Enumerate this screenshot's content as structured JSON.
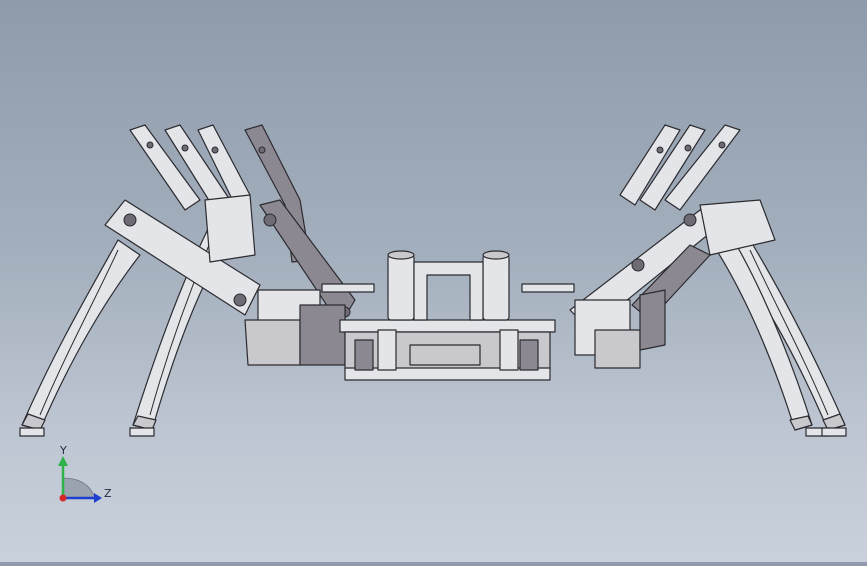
{
  "viewport": {
    "background_top": "#8f9bab",
    "background_bottom": "#c9d1dc",
    "model": "hexapod-robot"
  },
  "triad": {
    "y_label": "Y",
    "z_label": "Z",
    "y_color": "#2db34a",
    "z_color": "#1f3fd1",
    "origin_color": "#d62828"
  }
}
